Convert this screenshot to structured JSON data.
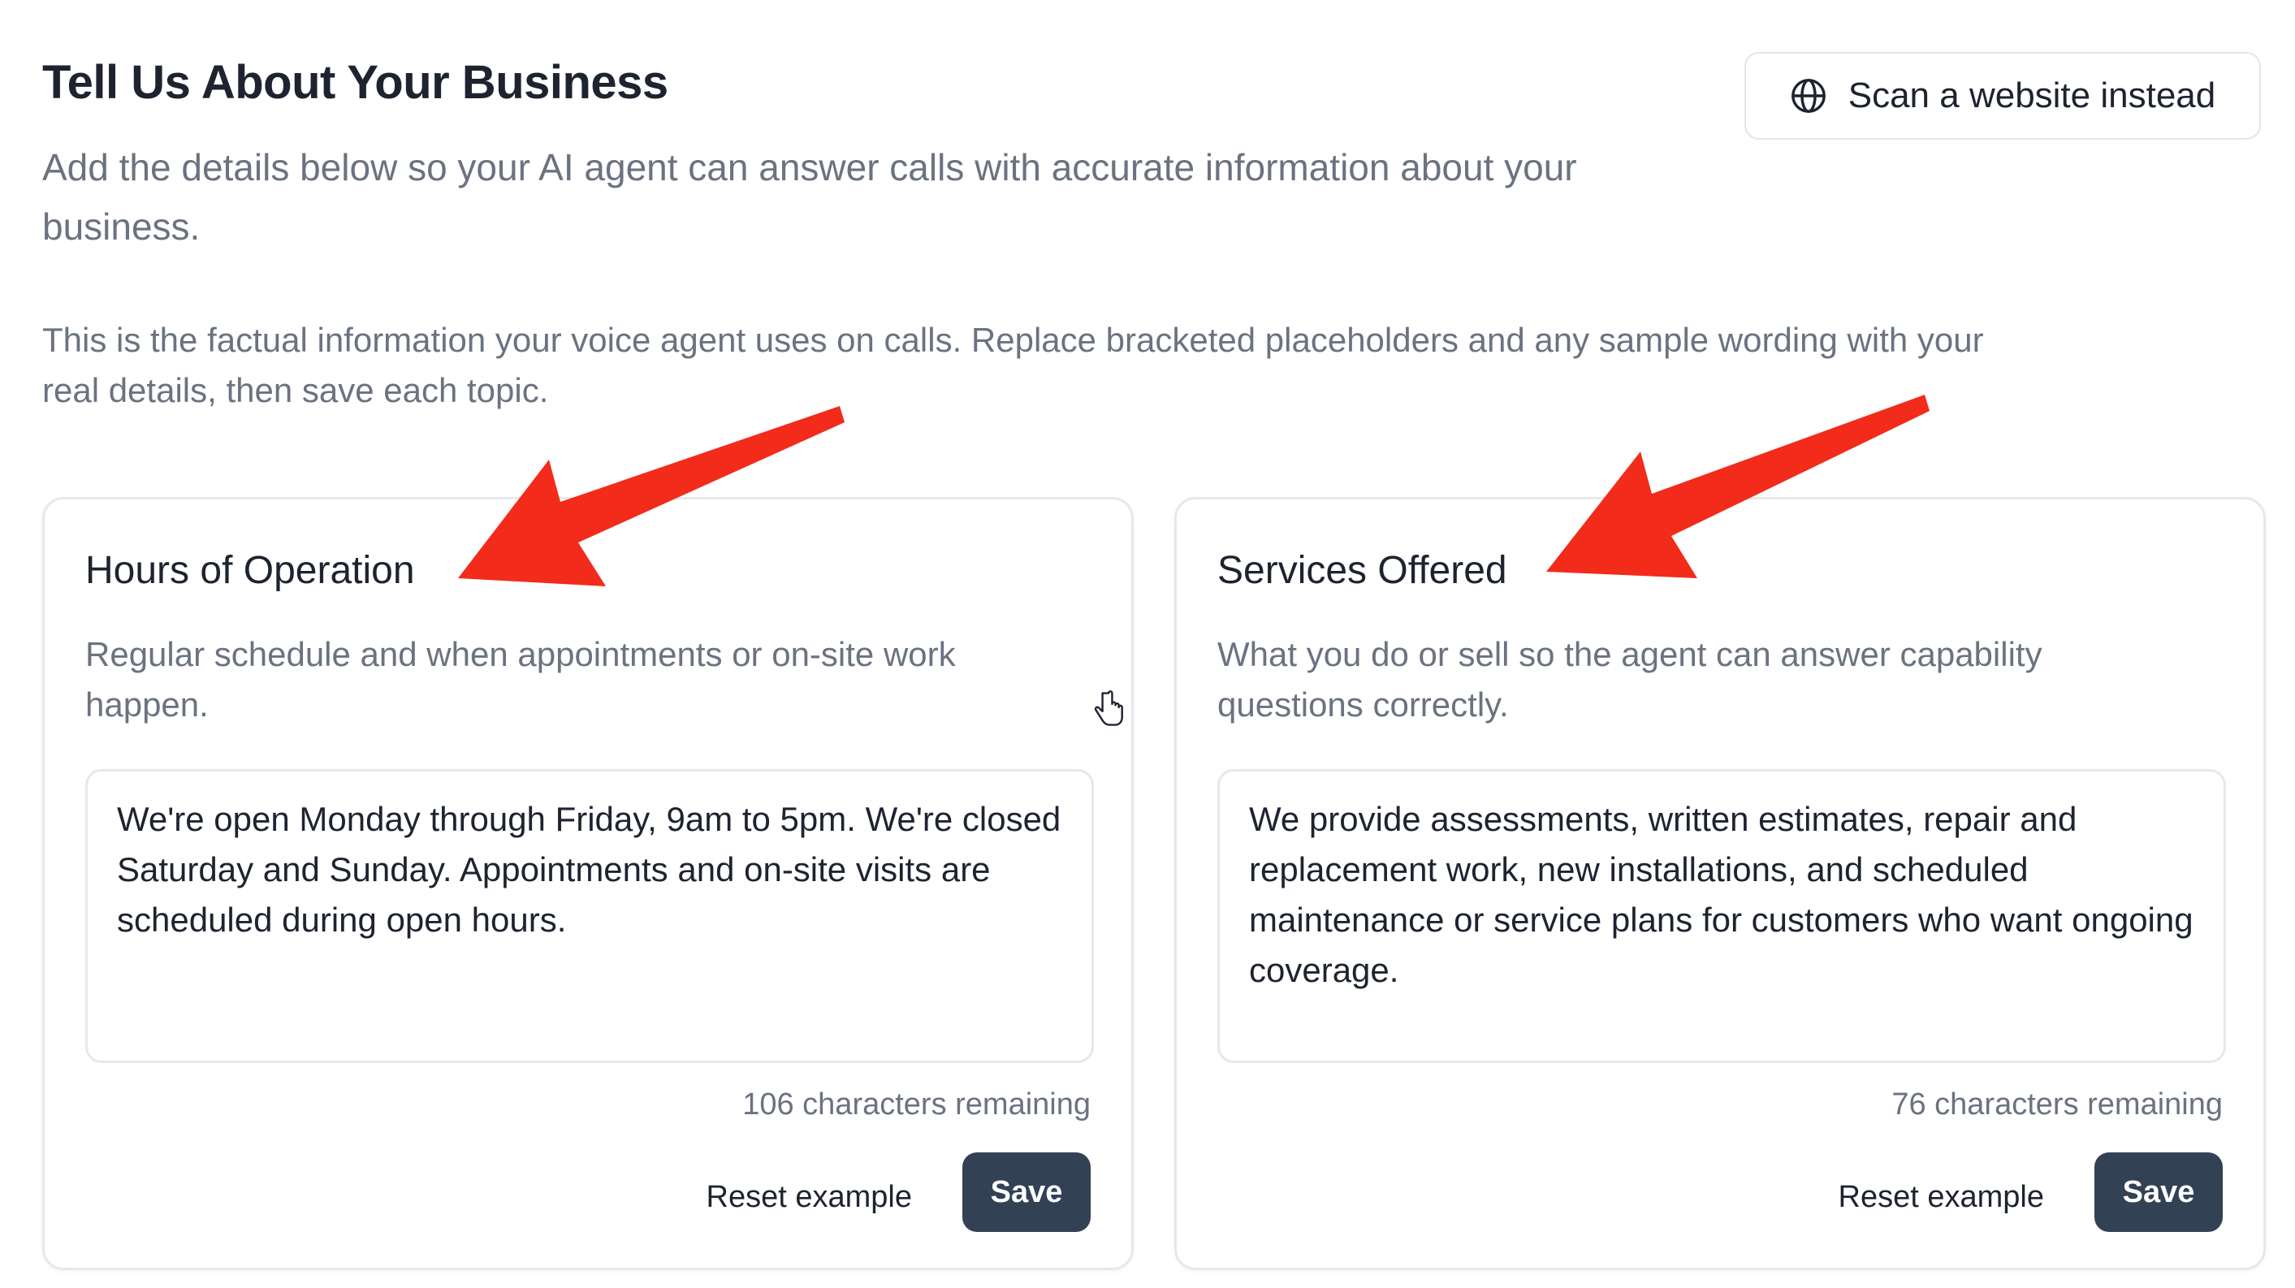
{
  "header": {
    "title": "Tell Us About Your Business",
    "subtitle": "Add the details below so your AI agent can answer calls with accurate information about your business.",
    "note": "This is the factual information your voice agent uses on calls. Replace bracketed placeholders and any sample wording with your real details, then save each topic.",
    "scan_button": {
      "label": "Scan a website instead",
      "icon": "globe-icon"
    }
  },
  "cards": [
    {
      "title": "Hours of Operation",
      "description": "Regular schedule and when appointments or on-site work happen.",
      "text": "We're open Monday through Friday, 9am to 5pm. We're closed Saturday and Sunday. Appointments and on-site visits are scheduled during open hours.",
      "chars_remaining": "106 characters remaining",
      "reset_label": "Reset example",
      "save_label": "Save"
    },
    {
      "title": "Services Offered",
      "description": "What you do or sell so the agent can answer capability questions correctly.",
      "text": "We provide assessments, written estimates, repair and replacement work, new installations, and scheduled maintenance or service plans for customers who want ongoing coverage.",
      "chars_remaining": "76 characters remaining",
      "reset_label": "Reset example",
      "save_label": "Save"
    }
  ],
  "annotations": {
    "arrow_color": "#f22b1b",
    "cursor_icon": "hand-pointer-icon"
  },
  "colors": {
    "save_button": "#334155",
    "muted_text": "#6b7280",
    "border": "#e6e8ec"
  }
}
